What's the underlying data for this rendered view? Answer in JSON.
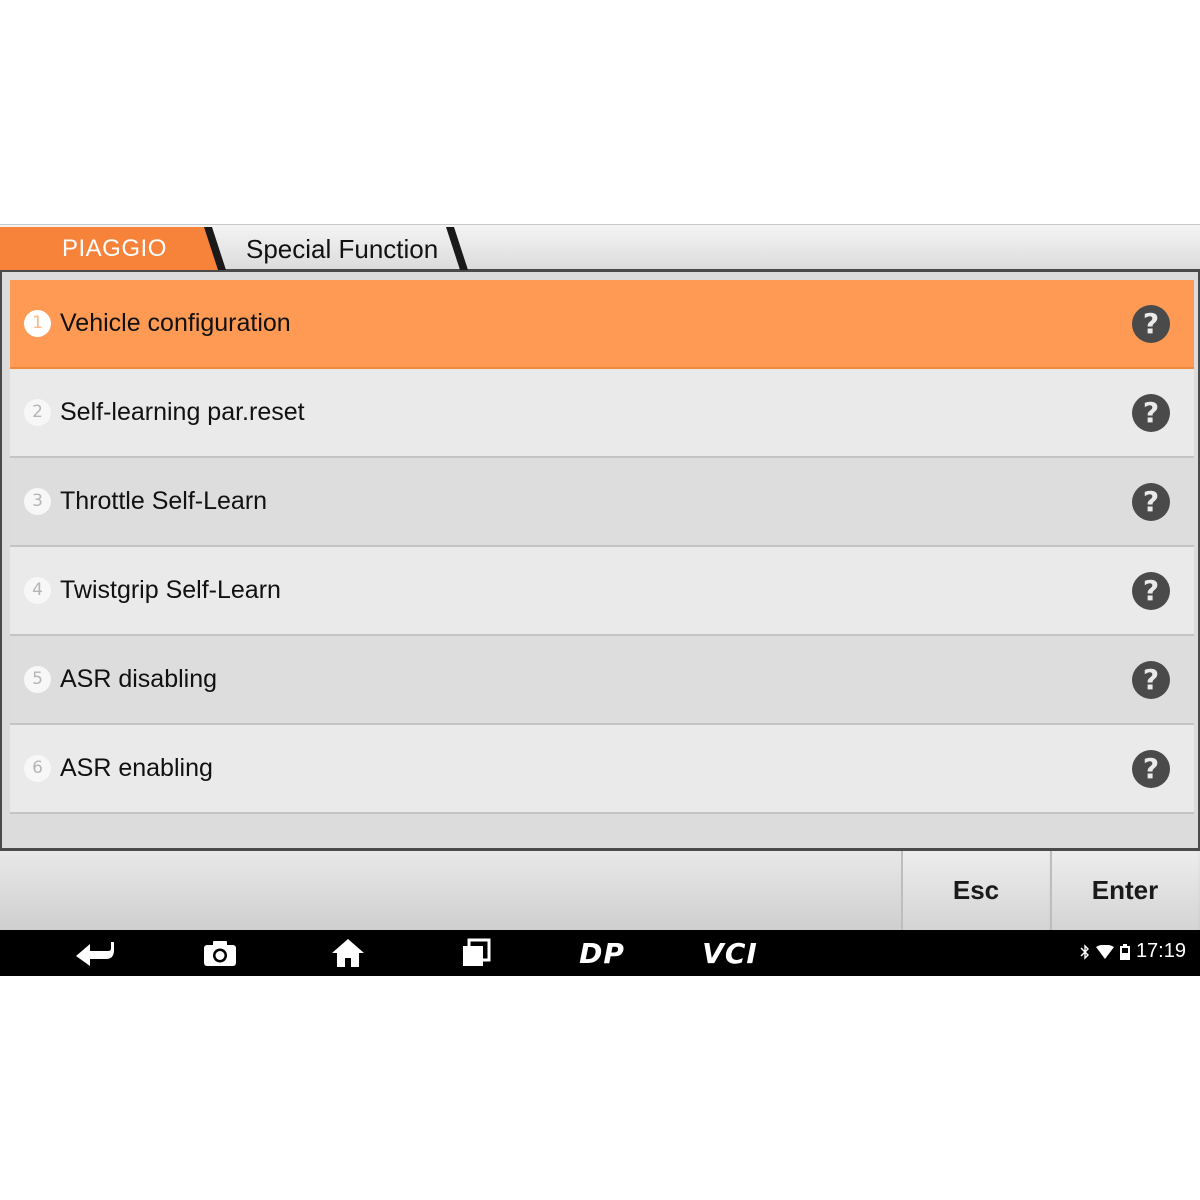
{
  "breadcrumb": {
    "brand": "PIAGGIO",
    "current": "Special Function"
  },
  "menu": {
    "items": [
      {
        "number": "1",
        "label": "Vehicle configuration",
        "selected": true
      },
      {
        "number": "2",
        "label": "Self-learning par.reset",
        "selected": false
      },
      {
        "number": "3",
        "label": "Throttle Self-Learn",
        "selected": false
      },
      {
        "number": "4",
        "label": "Twistgrip Self-Learn",
        "selected": false
      },
      {
        "number": "5",
        "label": "ASR disabling",
        "selected": false
      },
      {
        "number": "6",
        "label": "ASR enabling",
        "selected": false
      }
    ],
    "help_glyph": "?"
  },
  "actions": {
    "esc_label": "Esc",
    "enter_label": "Enter"
  },
  "navbar": {
    "icons": [
      "back-icon",
      "camera-icon",
      "home-icon",
      "recent-apps-icon",
      "dp-icon",
      "vci-icon"
    ],
    "dp_label": "DP",
    "vci_label": "VCI"
  },
  "status": {
    "time": "17:19",
    "icons": [
      "bluetooth-icon",
      "wifi-icon",
      "battery-icon"
    ]
  },
  "colors": {
    "accent": "#ff9a55",
    "brand_tab": "#f7823a",
    "help_icon": "#4a4a4a"
  }
}
